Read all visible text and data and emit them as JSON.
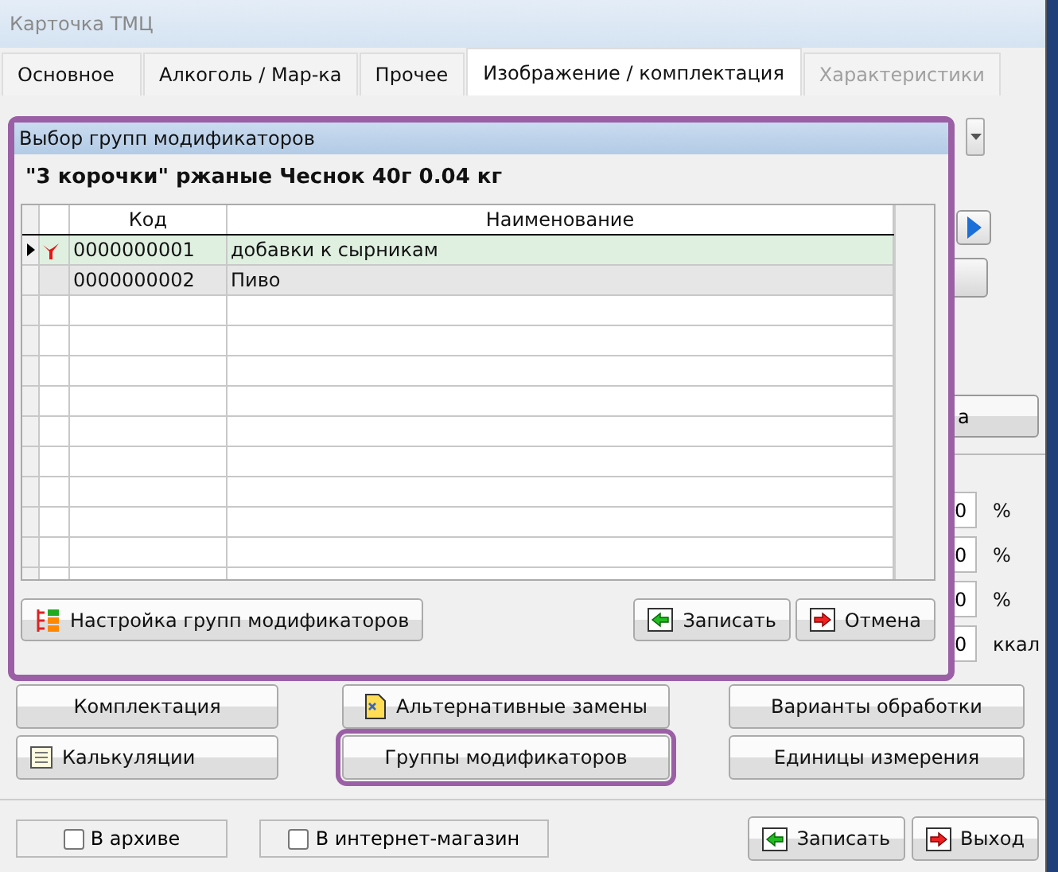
{
  "window": {
    "title": "Карточка ТМЦ"
  },
  "tabs": [
    {
      "label": "Основное",
      "selected": false,
      "disabled": false
    },
    {
      "label": "Алкоголь / Мар-ка",
      "selected": false,
      "disabled": false
    },
    {
      "label": "Прочее",
      "selected": false,
      "disabled": false
    },
    {
      "label": "Изображение / комплектация",
      "selected": true,
      "disabled": false
    },
    {
      "label": "Характеристики",
      "selected": false,
      "disabled": true
    }
  ],
  "background_panel": {
    "partial_button": "а",
    "fields": [
      {
        "value": "0",
        "unit": "%"
      },
      {
        "value": "0",
        "unit": "%"
      },
      {
        "value": "0",
        "unit": "%"
      },
      {
        "value": "0",
        "unit": "ккал"
      }
    ]
  },
  "dialog": {
    "title": "Выбор групп модификаторов",
    "product": "\"3 корочки\" ржаные Чеснок 40г 0.04 кг",
    "columns": [
      "Код",
      "Наименование"
    ],
    "rows": [
      {
        "code": "0000000001",
        "name": "добавки к сырникам",
        "selected": true,
        "marked": true
      },
      {
        "code": "0000000002",
        "name": "Пиво",
        "selected": false,
        "marked": false
      }
    ],
    "buttons": [
      {
        "label": "Настройка групп модификаторов",
        "kind": "tree"
      },
      {
        "label": "Записать",
        "kind": "save"
      },
      {
        "label": "Отмена",
        "kind": "cancel"
      }
    ]
  },
  "actions": [
    {
      "label": "Комплектация",
      "kind": "plain",
      "highlighted": false
    },
    {
      "label": "Альтернативные замены",
      "kind": "document",
      "highlighted": false
    },
    {
      "label": "Варианты обработки",
      "kind": "plain",
      "highlighted": false
    },
    {
      "label": "Калькуляции",
      "kind": "list",
      "highlighted": false
    },
    {
      "label": "Группы модификаторов",
      "kind": "plain",
      "highlighted": true
    },
    {
      "label": "Единицы измерения",
      "kind": "plain",
      "highlighted": false
    }
  ],
  "footer": {
    "checks": [
      {
        "label": "В архиве",
        "checked": false
      },
      {
        "label": "В интернет-магазин",
        "checked": false
      }
    ],
    "buttons": [
      {
        "label": "Записать",
        "kind": "save"
      },
      {
        "label": "Выход",
        "kind": "cancel"
      }
    ]
  }
}
